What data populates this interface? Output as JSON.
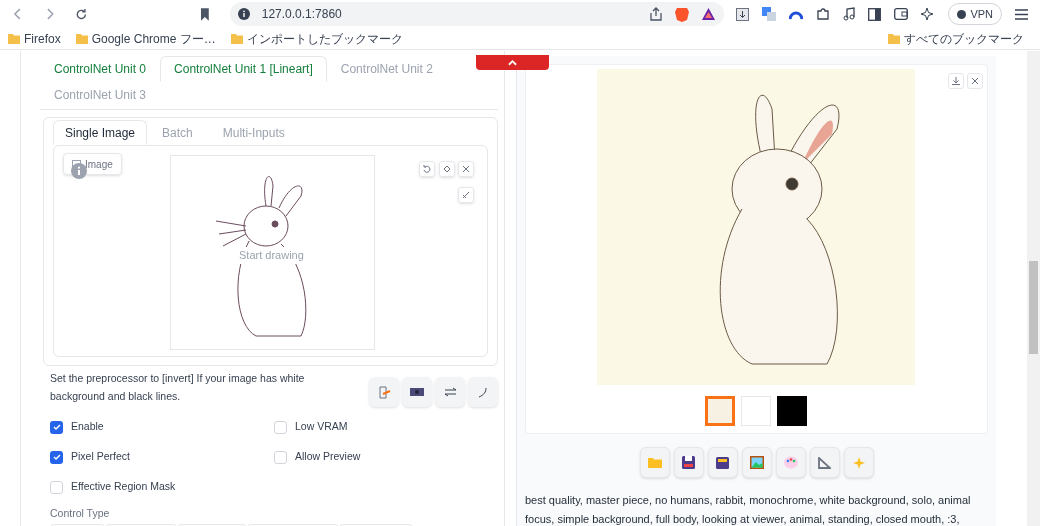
{
  "browser": {
    "url": "127.0.0.1:7860",
    "vpn_label": "VPN",
    "bookmarks": [
      {
        "label": "Firefox"
      },
      {
        "label": "Google Chrome フー…"
      },
      {
        "label": "インポートしたブックマーク"
      }
    ],
    "all_bookmarks_label": "すべてのブックマーク"
  },
  "controlnet": {
    "unit_tabs": [
      {
        "label": "ControlNet Unit 0",
        "selected": false,
        "enabled": true
      },
      {
        "label": "ControlNet Unit 1 [Lineart]",
        "selected": true,
        "enabled": true
      },
      {
        "label": "ControlNet Unit 2",
        "selected": false,
        "enabled": false
      },
      {
        "label": "ControlNet Unit 3",
        "selected": false,
        "enabled": false
      }
    ],
    "input_tabs": [
      {
        "label": "Single Image",
        "selected": true
      },
      {
        "label": "Batch",
        "selected": false
      },
      {
        "label": "Multi-Inputs",
        "selected": false
      }
    ],
    "image_label": "Image",
    "canvas_hint": "Start drawing",
    "hint": "Set the preprocessor to [invert] If your image has white background and black lines.",
    "checkboxes": [
      {
        "label": "Enable",
        "checked": true
      },
      {
        "label": "Low VRAM",
        "checked": false
      },
      {
        "label": "Pixel Perfect",
        "checked": true
      },
      {
        "label": "Allow Preview",
        "checked": false
      },
      {
        "label": "Effective Region Mask",
        "checked": false
      }
    ],
    "control_type_label": "Control Type"
  },
  "output": {
    "thumbnails": [
      {
        "kind": "color",
        "selected": true
      },
      {
        "kind": "sketch",
        "selected": false
      },
      {
        "kind": "dark",
        "selected": false
      }
    ],
    "prompt": "best quality, master piece, no humans, rabbit, monochrome, white background, solo, animal focus, simple background, full body, looking at viewer, animal, standing, closed mouth, :3,"
  }
}
